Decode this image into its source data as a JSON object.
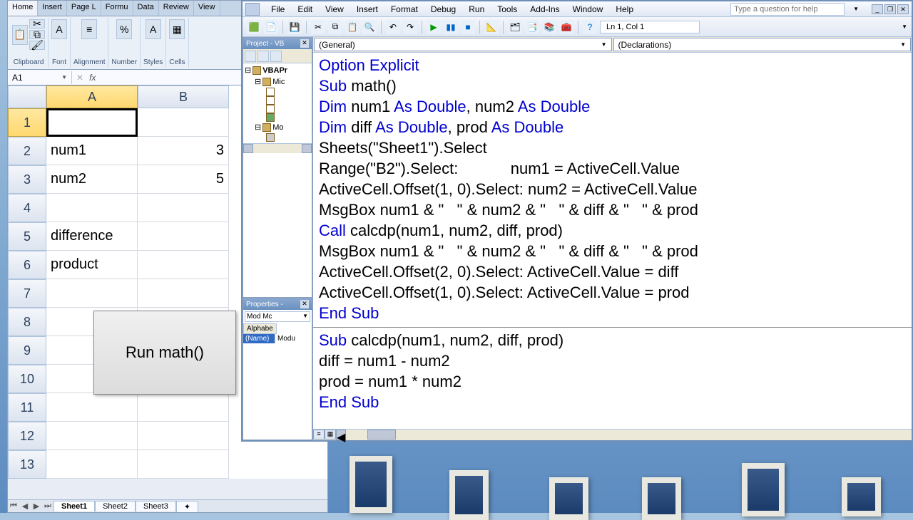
{
  "excel": {
    "tabs": [
      "Home",
      "Insert",
      "Page L",
      "Formu",
      "Data",
      "Review",
      "View"
    ],
    "active_tab": "Home",
    "ribbon_groups": [
      "Clipboard",
      "Font",
      "Alignment",
      "Number",
      "Styles",
      "Cells"
    ],
    "namebox": "A1",
    "cells": {
      "A2": "num1",
      "B2": "3",
      "A3": "num2",
      "B3": "5",
      "A5": "difference",
      "A6": "product"
    },
    "button_label": "Run math()",
    "sheets": [
      "Sheet1",
      "Sheet2",
      "Sheet3"
    ],
    "active_sheet": "Sheet1",
    "col_headers": [
      "A",
      "B"
    ],
    "row_count": 13
  },
  "vbe": {
    "menus": [
      "File",
      "Edit",
      "View",
      "Insert",
      "Format",
      "Debug",
      "Run",
      "Tools",
      "Add-Ins",
      "Window",
      "Help"
    ],
    "help_placeholder": "Type a question for help",
    "status": "Ln 1, Col 1",
    "project_title": "Project - VB",
    "project_root": "VBAPr",
    "project_items": [
      "Mic",
      "Mo"
    ],
    "properties_title": "Properties -",
    "prop_combo": "Mod Mc",
    "prop_tab": "Alphabe",
    "prop_name_label": "(Name)",
    "prop_name_value": "Modu",
    "combo_left": "(General)",
    "combo_right": "(Declarations)",
    "code": {
      "l1": "Option Explicit",
      "l2a": "Sub",
      "l2b": " math()",
      "l3a": "Dim",
      "l3b": " num1 ",
      "l3c": "As Double",
      "l3d": ", num2 ",
      "l3e": "As Double",
      "l4a": "Dim",
      "l4b": " diff ",
      "l4c": "As Double",
      "l4d": ", prod ",
      "l4e": "As Double",
      "l5": "Sheets(\"Sheet1\").Select",
      "l6": "Range(\"B2\").Select:            num1 = ActiveCell.Value",
      "l7": "ActiveCell.Offset(1, 0).Select: num2 = ActiveCell.Value",
      "l8": "MsgBox num1 & \"   \" & num2 & \"   \" & diff & \"   \" & prod",
      "l9a": "Call",
      "l9b": " calcdp(num1, num2, diff, prod)",
      "l10": "MsgBox num1 & \"   \" & num2 & \"   \" & diff & \"   \" & prod",
      "l11": "ActiveCell.Offset(2, 0).Select: ActiveCell.Value = diff",
      "l12": "ActiveCell.Offset(1, 0).Select: ActiveCell.Value = prod",
      "l13": "End Sub",
      "l14a": "Sub",
      "l14b": " calcdp(num1, num2, diff, prod)",
      "l15": "diff = num1 - num2",
      "l16": "prod = num1 * num2",
      "l17": "End Sub"
    }
  }
}
